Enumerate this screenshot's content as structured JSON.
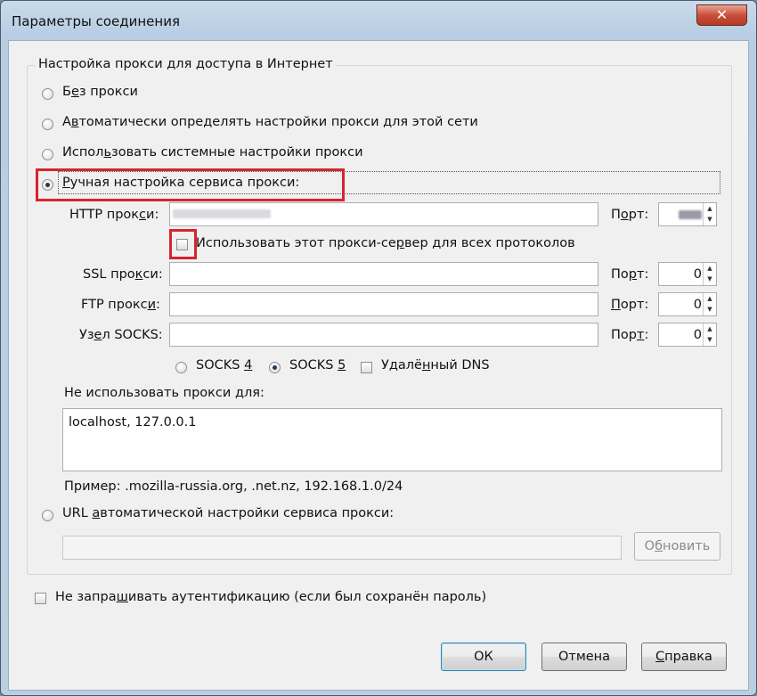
{
  "window": {
    "title": "Параметры соединения",
    "close_glyph": "✕"
  },
  "proxy_group": {
    "legend": "Настройка прокси для доступа в Интернет",
    "options": {
      "no_proxy": {
        "pre": "Б",
        "key": "е",
        "post": "з прокси",
        "checked": false
      },
      "auto_detect": {
        "pre": "А",
        "key": "в",
        "post": "томатически определять настройки прокси для этой сети",
        "checked": false
      },
      "system": {
        "pre": "Испол",
        "key": "ь",
        "post": "зовать системные настройки прокси",
        "checked": false
      },
      "manual": {
        "pre": "",
        "key": "Р",
        "post": "учная настройка сервиса прокси:",
        "checked": true
      },
      "auto_url": {
        "pre": "URL ",
        "key": "а",
        "post": "втоматической настройки сервиса прокси:",
        "checked": false
      }
    },
    "http": {
      "label_pre": "HTTP прок",
      "label_key": "с",
      "label_post": "и:",
      "port_pre": "П",
      "port_key": "о",
      "port_post": "рт:"
    },
    "use_for_all": {
      "pre": "Использовать этот прокси-се",
      "key": "р",
      "post": "вер для всех протоколов",
      "checked": false
    },
    "ssl": {
      "label_pre": "SSL про",
      "label_key": "к",
      "label_post": "си:",
      "port_pre": "По",
      "port_key": "р",
      "port_post": "т:",
      "port_value": "0"
    },
    "ftp": {
      "label_pre": "FTP прокс",
      "label_key": "и",
      "label_post": ":",
      "port_pre": "",
      "port_key": "П",
      "port_post": "орт:",
      "port_value": "0"
    },
    "socks": {
      "label_pre": "Уз",
      "label_key": "е",
      "label_post": "л SOCKS:",
      "port_pre": "Пор",
      "port_key": "т",
      "port_post": ":",
      "port_value": "0"
    },
    "socks4": {
      "pre": "SOCKS ",
      "key": "4",
      "post": "",
      "checked": false
    },
    "socks5": {
      "pre": "SOCKS ",
      "key": "5",
      "post": "",
      "checked": true
    },
    "remote_dns": {
      "pre": "Удалё",
      "key": "н",
      "post": "ный DNS",
      "checked": false
    },
    "no_proxy_for": {
      "pre": "Не использовать прокси ",
      "key": "д",
      "post": "ля:",
      "value": "localhost, 127.0.0.1"
    },
    "example": "Пример: .mozilla-russia.org, .net.nz, 192.168.1.0/24",
    "reload": {
      "pre": "О",
      "key": "б",
      "post": "новить"
    }
  },
  "no_auth": {
    "pre": "Не запра",
    "key": "ш",
    "post": "ивать аутентификацию (если был сохранён пароль)",
    "checked": false
  },
  "buttons": {
    "ok": "ОК",
    "cancel": "Отмена",
    "help": {
      "pre": "",
      "key": "С",
      "post": "правка"
    }
  },
  "colors": {
    "highlight": "#d9232e",
    "accent": "#3c7fb1"
  }
}
